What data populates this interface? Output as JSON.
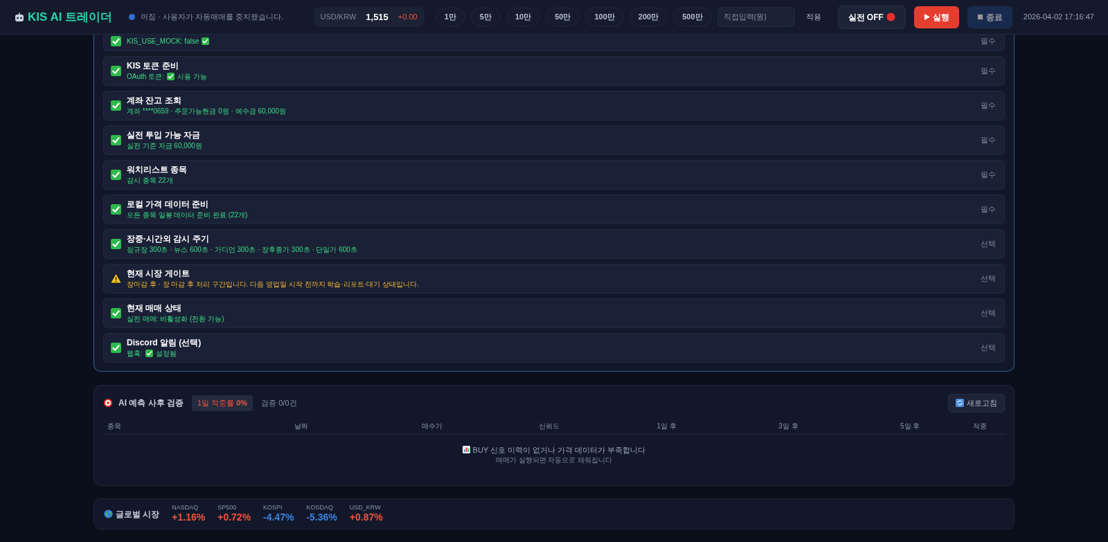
{
  "header": {
    "title": "KIS AI 트레이더",
    "status": {
      "running": false,
      "text": "꺼짐 · 사용자가 자동매매를 중지했습니다."
    },
    "fx": {
      "label": "USD/KRW",
      "value": "1,515",
      "change": "+0.00",
      "rising": true
    },
    "amounts": [
      "1만",
      "5만",
      "10만",
      "50만",
      "100만",
      "200만",
      "500만"
    ],
    "amount_input": {
      "placeholder": "직접입력(원)"
    },
    "apply_button": "적용",
    "live_toggle": {
      "label": "실전 OFF",
      "on": false
    },
    "run_button": {
      "label": "실행",
      "disabled": false
    },
    "stop_button": {
      "label": "종료",
      "disabled": true
    },
    "datetime": "2026-04-02 17:16:47"
  },
  "checklist": [
    {
      "kind": "ok",
      "detail": [
        {
          "kind": "text",
          "text": "KIS_USE_MOCK: false"
        },
        {
          "kind": "check"
        }
      ],
      "tag": "필수"
    },
    {
      "kind": "ok",
      "title": "KIS 토큰 준비",
      "detail": [
        {
          "kind": "text",
          "text": "OAuth 토큰:"
        },
        {
          "kind": "check"
        },
        {
          "kind": "text",
          "text": "사용 가능"
        }
      ],
      "tag": "필수"
    },
    {
      "kind": "ok",
      "title": "계좌 잔고 조회",
      "detail": [
        {
          "kind": "text",
          "text": "계좌 ****0659 · 주문가능현금 0원 · 예수금 60,000원"
        }
      ],
      "tag": "필수"
    },
    {
      "kind": "ok",
      "title": "실전 투입 가능 자금",
      "detail": [
        {
          "kind": "text",
          "text": "실전 기준 자금 60,000원"
        }
      ],
      "tag": "필수"
    },
    {
      "kind": "ok",
      "title": "워치리스트 종목",
      "detail": [
        {
          "kind": "text",
          "text": "감시 종목 22개"
        }
      ],
      "tag": "필수"
    },
    {
      "kind": "ok",
      "title": "로컬 가격 데이터 준비",
      "detail": [
        {
          "kind": "text",
          "text": "모든 종목 일봉 데이터 준비 완료 (22개)"
        }
      ],
      "tag": "필수"
    },
    {
      "kind": "ok",
      "title": "장중·시간외 감시 주기",
      "detail": [
        {
          "kind": "text",
          "text": "정규장 300초 · 뉴스 600초 · 가디언 300초 · 장후종가 300초 · 단일가 600초"
        }
      ],
      "tag": "선택"
    },
    {
      "kind": "warn",
      "title": "현재 시장 게이트",
      "detail": [
        {
          "kind": "text",
          "text": "장마감 후 · 장 마감 후 처리 구간입니다. 다음 영업일 시작 전까지 학습·리포트·대기 상태입니다."
        }
      ],
      "tag": "선택"
    },
    {
      "kind": "ok",
      "title": "현재 매매 상태",
      "detail": [
        {
          "kind": "text",
          "text": "실전 매매: 비활성화 (전환 가능)"
        }
      ],
      "tag": "선택"
    },
    {
      "kind": "ok",
      "title": "Discord 알림 (선택)",
      "detail": [
        {
          "kind": "text",
          "text": "웹훅:"
        },
        {
          "kind": "check"
        },
        {
          "kind": "text",
          "text": "설정됨"
        }
      ],
      "tag": "선택"
    }
  ],
  "verification": {
    "title": "AI 예측 사후 검증",
    "hit_rate": "1일 적중률 **0%**",
    "count": "검증 0/0건",
    "refresh_button": "새로고침",
    "columns": [
      "종목",
      "날짜",
      "매수가",
      "신뢰도",
      "1일 후",
      "3일 후",
      "5일 후",
      "적중"
    ],
    "empty_message": "BUY 신호 이력이 없거나 가격 데이터가 부족합니다",
    "empty_hint": "매매가 실행되면 자동으로 채워집니다"
  },
  "global_market": {
    "title": "글로벌 시장",
    "items": [
      {
        "label": "NASDAQ",
        "value": "+1.16%",
        "rising": true
      },
      {
        "label": "SP500",
        "value": "+0.72%",
        "rising": true
      },
      {
        "label": "KOSPI",
        "value": "-4.47%",
        "rising": false
      },
      {
        "label": "KOSDAQ",
        "value": "-5.36%",
        "rising": false
      },
      {
        "label": "USD_KRW",
        "value": "+0.87%",
        "rising": true
      }
    ]
  }
}
